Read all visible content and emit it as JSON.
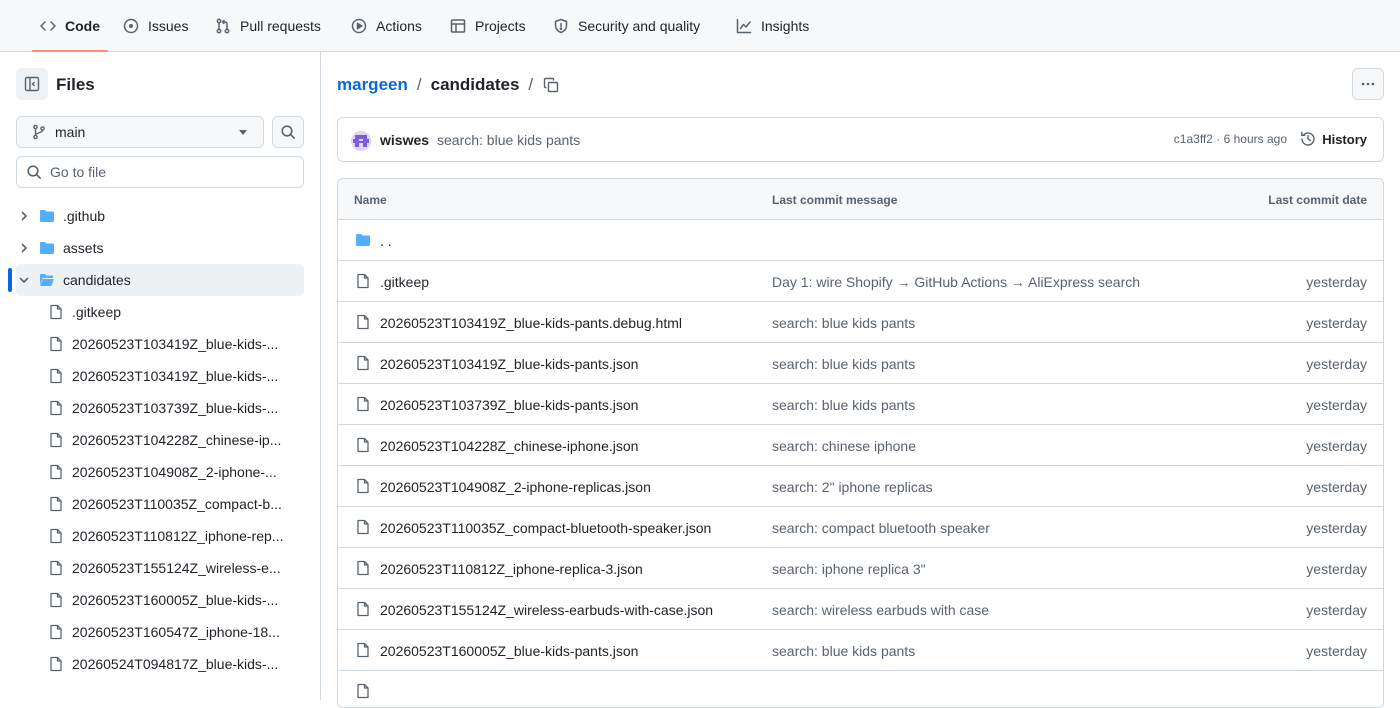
{
  "nav": {
    "tabs": [
      {
        "label": "Code",
        "icon": "code-icon",
        "active": true
      },
      {
        "label": "Issues",
        "icon": "issue-icon"
      },
      {
        "label": "Pull requests",
        "icon": "pull-request-icon"
      },
      {
        "label": "Actions",
        "icon": "play-icon"
      },
      {
        "label": "Projects",
        "icon": "table-icon"
      },
      {
        "label": "Security and quality",
        "icon": "shield-icon"
      },
      {
        "label": "Insights",
        "icon": "graph-icon"
      }
    ]
  },
  "sidebar": {
    "title": "Files",
    "branch": "main",
    "goto_placeholder": "Go to file",
    "tree": [
      {
        "type": "folder",
        "label": ".github",
        "expanded": false
      },
      {
        "type": "folder",
        "label": "assets",
        "expanded": false
      },
      {
        "type": "folder",
        "label": "candidates",
        "expanded": true,
        "selected": true
      },
      {
        "type": "file",
        "label": ".gitkeep"
      },
      {
        "type": "file",
        "label": "20260523T103419Z_blue-kids-..."
      },
      {
        "type": "file",
        "label": "20260523T103419Z_blue-kids-..."
      },
      {
        "type": "file",
        "label": "20260523T103739Z_blue-kids-..."
      },
      {
        "type": "file",
        "label": "20260523T104228Z_chinese-ip..."
      },
      {
        "type": "file",
        "label": "20260523T104908Z_2-iphone-..."
      },
      {
        "type": "file",
        "label": "20260523T110035Z_compact-b..."
      },
      {
        "type": "file",
        "label": "20260523T110812Z_iphone-rep..."
      },
      {
        "type": "file",
        "label": "20260523T155124Z_wireless-e..."
      },
      {
        "type": "file",
        "label": "20260523T160005Z_blue-kids-..."
      },
      {
        "type": "file",
        "label": "20260523T160547Z_iphone-18..."
      },
      {
        "type": "file",
        "label": "20260524T094817Z_blue-kids-..."
      }
    ]
  },
  "breadcrumb": {
    "repo": "margeen",
    "sep1": "/",
    "folder": "candidates",
    "sep2": "/"
  },
  "commit": {
    "author": "wiswes",
    "message": "search: blue kids pants",
    "meta": "c1a3ff2 · 6 hours ago",
    "history_label": "History"
  },
  "table": {
    "headers": {
      "name": "Name",
      "message": "Last commit message",
      "date": "Last commit date"
    },
    "parent": ". .",
    "rows": [
      {
        "name": ".gitkeep",
        "message": "Day 1: wire Shopify → GitHub Actions → AliExpress search",
        "date": "yesterday"
      },
      {
        "name": "20260523T103419Z_blue-kids-pants.debug.html",
        "message": "search: blue kids pants",
        "date": "yesterday"
      },
      {
        "name": "20260523T103419Z_blue-kids-pants.json",
        "message": "search: blue kids pants",
        "date": "yesterday"
      },
      {
        "name": "20260523T103739Z_blue-kids-pants.json",
        "message": "search: blue kids pants",
        "date": "yesterday"
      },
      {
        "name": "20260523T104228Z_chinese-iphone.json",
        "message": "search: chinese iphone",
        "date": "yesterday"
      },
      {
        "name": "20260523T104908Z_2-iphone-replicas.json",
        "message": "search: 2\" iphone replicas",
        "date": "yesterday"
      },
      {
        "name": "20260523T110035Z_compact-bluetooth-speaker.json",
        "message": "search: compact bluetooth speaker",
        "date": "yesterday"
      },
      {
        "name": "20260523T110812Z_iphone-replica-3.json",
        "message": "search: iphone replica 3\"",
        "date": "yesterday"
      },
      {
        "name": "20260523T155124Z_wireless-earbuds-with-case.json",
        "message": "search: wireless earbuds with case",
        "date": "yesterday"
      },
      {
        "name": "20260523T160005Z_blue-kids-pants.json",
        "message": "search: blue kids pants",
        "date": "yesterday"
      }
    ]
  },
  "colors": {
    "accent": "#0969da",
    "folder": "#54aeff",
    "active_tab_underline": "#fd8c73"
  }
}
